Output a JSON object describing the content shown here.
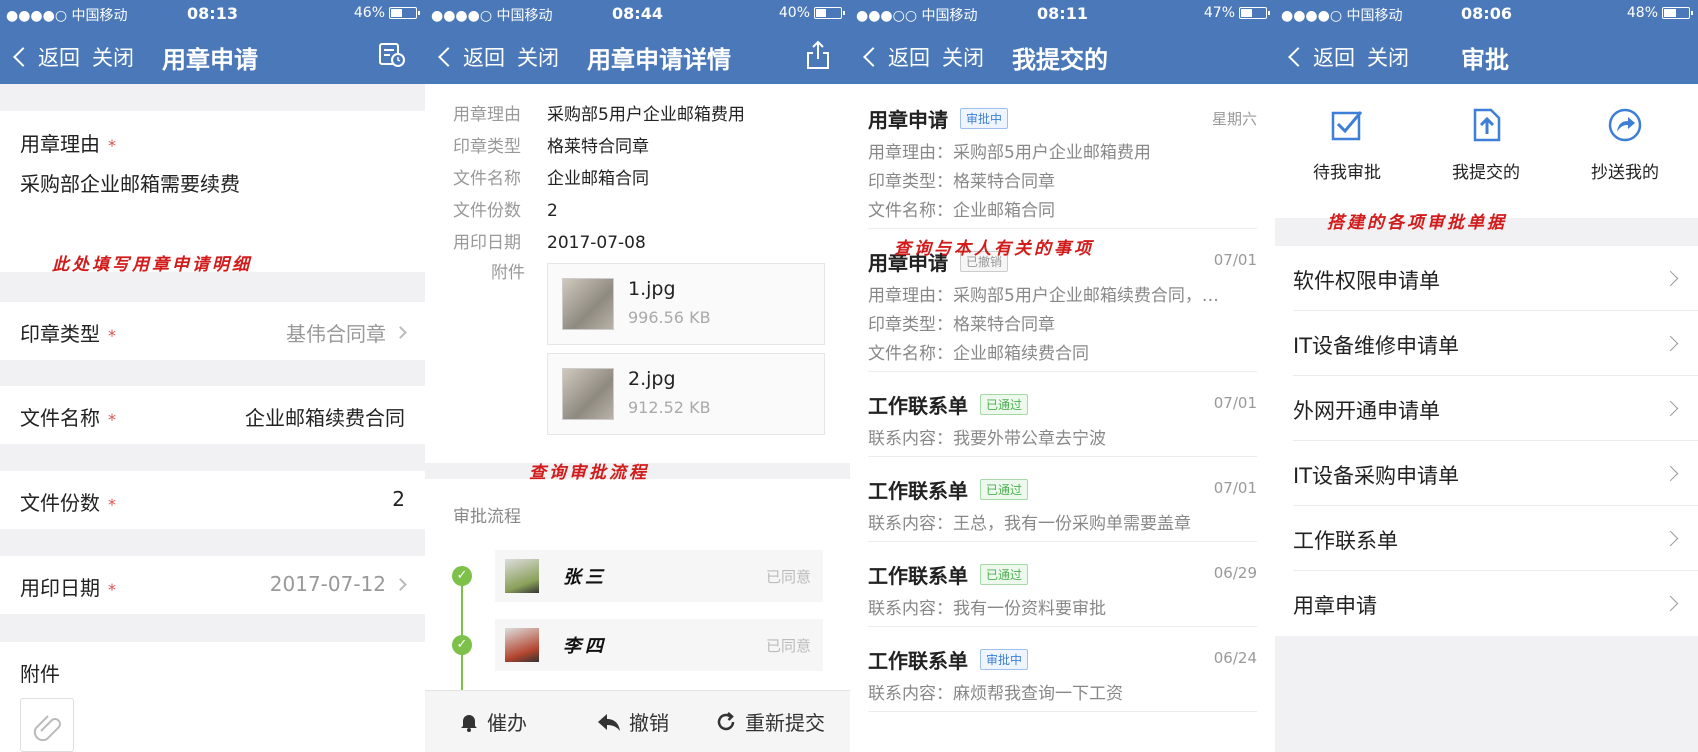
{
  "panel1": {
    "status": {
      "carrier": "●●●●○ 中国移动",
      "time": "08:13",
      "battery": "46%",
      "battery_level": 0.46
    },
    "nav": {
      "back": "返回",
      "close": "关闭",
      "title": "用章申请",
      "icon": "history-form-icon"
    },
    "reason": {
      "label": "用章理由",
      "required": "*",
      "value": "采购部企业邮箱需要续费"
    },
    "annotation": "此处填写用章申请明细",
    "seal_type": {
      "label": "印章类型",
      "required": "*",
      "value": "基伟合同章"
    },
    "file_name": {
      "label": "文件名称",
      "required": "*",
      "value": "企业邮箱续费合同"
    },
    "copies": {
      "label": "文件份数",
      "required": "*",
      "value": "2"
    },
    "date": {
      "label": "用印日期",
      "required": "*",
      "value": "2017-07-12"
    },
    "attachment": {
      "label": "附件",
      "icon": "paperclip-icon"
    }
  },
  "panel2": {
    "status": {
      "carrier": "●●●●○ 中国移动",
      "time": "08:44",
      "battery": "40%",
      "battery_level": 0.4
    },
    "nav": {
      "back": "返回",
      "close": "关闭",
      "title": "用章申请详情",
      "icon": "share-icon"
    },
    "details": [
      {
        "k": "用章理由",
        "v": "采购部5用户企业邮箱费用"
      },
      {
        "k": "印章类型",
        "v": "格莱特合同章"
      },
      {
        "k": "文件名称",
        "v": "企业邮箱合同"
      },
      {
        "k": "文件份数",
        "v": "2"
      },
      {
        "k": "用印日期",
        "v": "2017-07-08"
      }
    ],
    "attachment_label": "附件",
    "files": [
      {
        "name": "1.jpg",
        "size": "996.56 KB"
      },
      {
        "name": "2.jpg",
        "size": "912.52 KB"
      }
    ],
    "annotation": "查询审批流程",
    "flow_title": "审批流程",
    "flow": [
      {
        "name": "张三",
        "status": "已同意"
      },
      {
        "name": "李四",
        "status": "已同意"
      }
    ],
    "actions": {
      "urge": "催办",
      "revoke": "撤销",
      "resubmit": "重新提交"
    }
  },
  "panel3": {
    "status": {
      "carrier": "●●●○○ 中国移动",
      "time": "08:11",
      "battery": "47%",
      "battery_level": 0.47
    },
    "nav": {
      "back": "返回",
      "close": "关闭",
      "title": "我提交的"
    },
    "annotation": "查询与本人有关的事项",
    "items": [
      {
        "title": "用章申请",
        "badge": "审批中",
        "badge_type": "blue",
        "date": "星期六",
        "lines": [
          "用章理由：采购部5用户企业邮箱费用",
          "印章类型：格莱特合同章",
          "文件名称：企业邮箱合同"
        ]
      },
      {
        "title": "用章申请",
        "badge": "已撤销",
        "badge_type": "grey",
        "date": "07/01",
        "lines": [
          "用章理由：采购部5用户企业邮箱续费合同，…",
          "印章类型：格莱特合同章",
          "文件名称：企业邮箱续费合同"
        ]
      },
      {
        "title": "工作联系单",
        "badge": "已通过",
        "badge_type": "green",
        "date": "07/01",
        "lines": [
          "联系内容：我要外带公章去宁波"
        ]
      },
      {
        "title": "工作联系单",
        "badge": "已通过",
        "badge_type": "green",
        "date": "07/01",
        "lines": [
          "联系内容：王总，我有一份采购单需要盖章"
        ]
      },
      {
        "title": "工作联系单",
        "badge": "已通过",
        "badge_type": "green",
        "date": "06/29",
        "lines": [
          "联系内容：我有一份资料要审批"
        ]
      },
      {
        "title": "工作联系单",
        "badge": "审批中",
        "badge_type": "blue",
        "date": "06/24",
        "lines": [
          "联系内容：麻烦帮我查询一下工资"
        ]
      }
    ]
  },
  "panel4": {
    "status": {
      "carrier": "●●●●○ 中国移动",
      "time": "08:06",
      "battery": "48%",
      "battery_level": 0.48
    },
    "nav": {
      "back": "返回",
      "close": "关闭",
      "title": "审批"
    },
    "shortcuts": [
      {
        "label": "待我审批",
        "icon": "checkbox-icon"
      },
      {
        "label": "我提交的",
        "icon": "upload-doc-icon"
      },
      {
        "label": "抄送我的",
        "icon": "forward-arrow-icon"
      }
    ],
    "annotation": "搭建的各项审批单据",
    "forms": [
      "软件权限申请单",
      "IT设备维修申请单",
      "外网开通申请单",
      "IT设备采购申请单",
      "工作联系单",
      "用章申请"
    ]
  }
}
